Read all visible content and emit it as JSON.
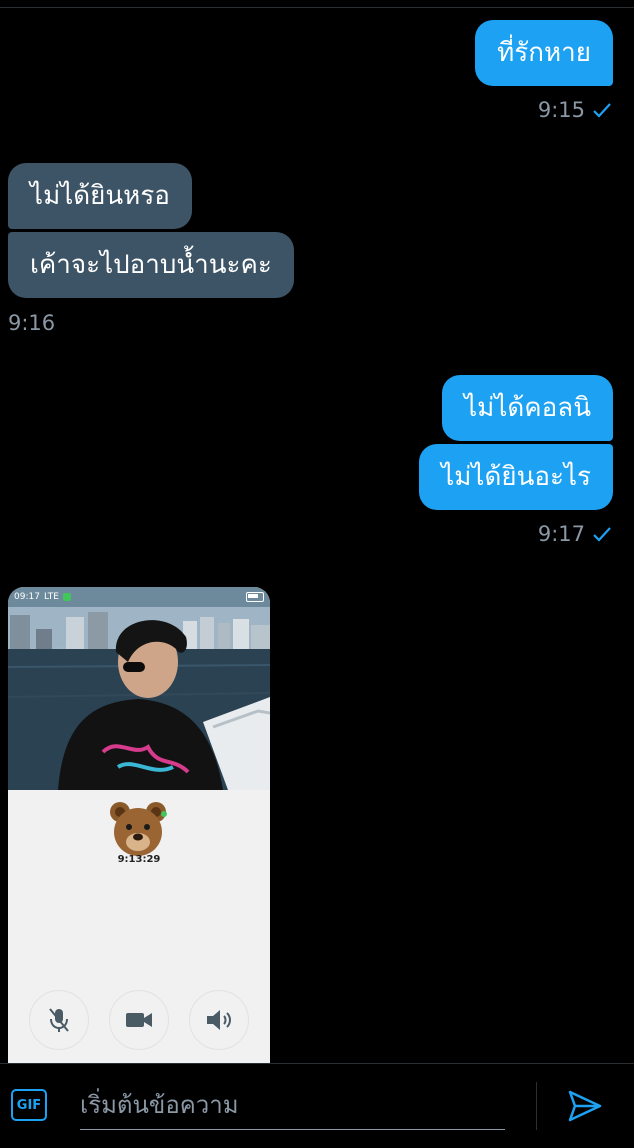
{
  "messages": [
    {
      "text": "ที่รักหาย"
    },
    {
      "time": "9:15"
    },
    {
      "text": "ไม่ได้ยินหรอ"
    },
    {
      "text": "เค้าจะไปอาบน้ำนะคะ"
    },
    {
      "time": "9:16"
    },
    {
      "text": "ไม่ได้คอลนิ"
    },
    {
      "text": "ไม่ได้ยินอะไร"
    },
    {
      "time": "9:17"
    }
  ],
  "image_message": {
    "status_time": "09:17",
    "status_network": "LTE",
    "battery_level": "",
    "call_timer": "9:13:29",
    "controls": [
      "mic-off-icon",
      "video-icon",
      "speaker-icon"
    ]
  },
  "composer": {
    "gif_label": "GIF",
    "placeholder": "เริ่มต้นข้อความ"
  },
  "colors": {
    "accent": "#1da1f2",
    "incoming_bubble": "#3d5466",
    "meta_text": "#8b98a5",
    "background": "#000000"
  }
}
